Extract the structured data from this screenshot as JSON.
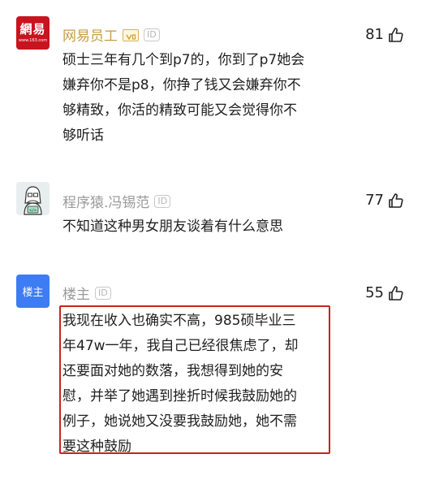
{
  "comments": [
    {
      "username": "网易员工",
      "avatar_label": "網易",
      "avatar_sub": "www.163.com",
      "id_badge": "ID",
      "likes": "81",
      "text": "硕士三年有几个到p7的，你到了p7她会\n嫌弃你不是p8，你挣了钱又会嫌弃你不\n够精致，你活的精致可能又会觉得你不\n够听话"
    },
    {
      "username": "程序猿.冯锡范",
      "avatar_label": "</>",
      "id_badge": "ID",
      "likes": "77",
      "text": "不知道这种男女朋友谈着有什么意思"
    },
    {
      "username": "楼主",
      "avatar_label": "楼主",
      "id_badge": "ID",
      "likes": "55",
      "text": "我现在收入也确实不高，985硕毕业三\n年47w一年，我自己已经很焦虑了，却\n还要面对她的数落，我想得到她的安\n慰，并举了她遇到挫折时候我鼓励她的\n例子，她说她又没要我鼓励她，她不需\n要这种鼓励"
    }
  ],
  "colors": {
    "netease_red": "#c8141f",
    "host_blue": "#3d7cf2",
    "gold_name": "#c79c46",
    "highlight_red": "#c8231f"
  },
  "icons": {
    "like": "thumbs-up-icon",
    "vip": "vip-badge-icon"
  }
}
